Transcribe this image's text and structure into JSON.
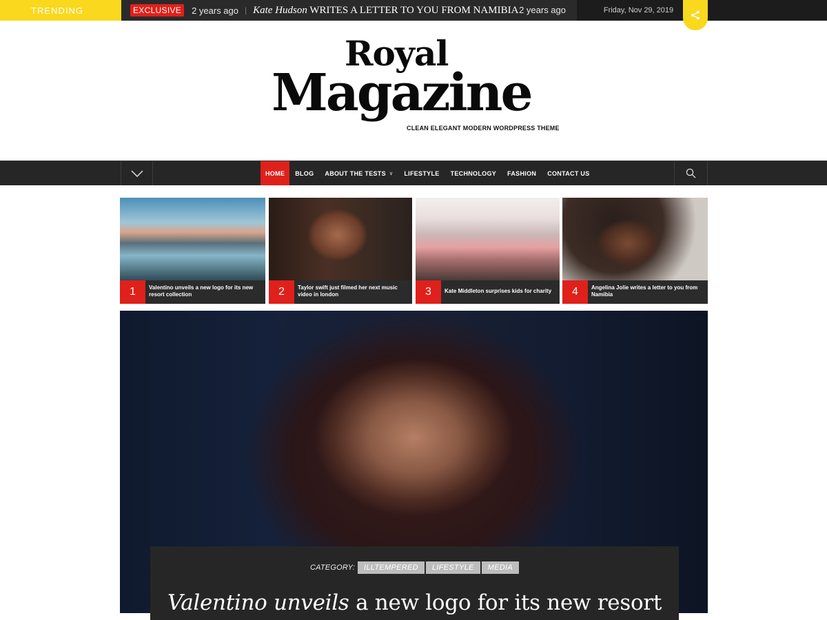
{
  "topbar": {
    "trending_label": "TRENDING",
    "exclusive_badge": "EXCLUSIVE",
    "time_ago": "2 years ago",
    "separator": "|",
    "headline_name": "Kate Hudson",
    "headline_rest": " WRITES A LETTER TO YOU FROM NAMIBIA",
    "time_ago_right": "2 years ago",
    "date": "Friday, Nov 29, 2019",
    "share_icon": "share-icon"
  },
  "logo": {
    "royal": "Royal",
    "magazine": "Magazine",
    "tagline": "CLEAN ELEGANT MODERN WORDPRESS THEME"
  },
  "nav": {
    "toggle_icon": "chevron-down-icon",
    "items": [
      {
        "label": "HOME",
        "active": true
      },
      {
        "label": "BLOG"
      },
      {
        "label": "ABOUT THE TESTS",
        "has_dropdown": true
      },
      {
        "label": "LIFESTYLE"
      },
      {
        "label": "TECHNOLOGY"
      },
      {
        "label": "FASHION"
      },
      {
        "label": "CONTACT US"
      }
    ],
    "search_icon": "search-icon",
    "accent": "#e0201b"
  },
  "featured": [
    {
      "num": "1",
      "title": "Valentino unveils a new logo for its new resort collection"
    },
    {
      "num": "2",
      "title": "Taylor swift just filmed her next music video in london"
    },
    {
      "num": "3",
      "title": "Kate Middleton surprises kids for charity"
    },
    {
      "num": "4",
      "title": "Angelina Jolie writes a letter to you from Namibia"
    }
  ],
  "hero": {
    "category_label": "CATEGORY:",
    "categories": [
      "ILLTEMPERED",
      "LIFESTYLE",
      "MEDIA"
    ],
    "title_italic": "Valentino unveils",
    "title_rest": " a new logo for its new resort"
  },
  "colors": {
    "trending_yellow": "#f9d81d",
    "dark": "#262626",
    "red": "#e0201b"
  }
}
